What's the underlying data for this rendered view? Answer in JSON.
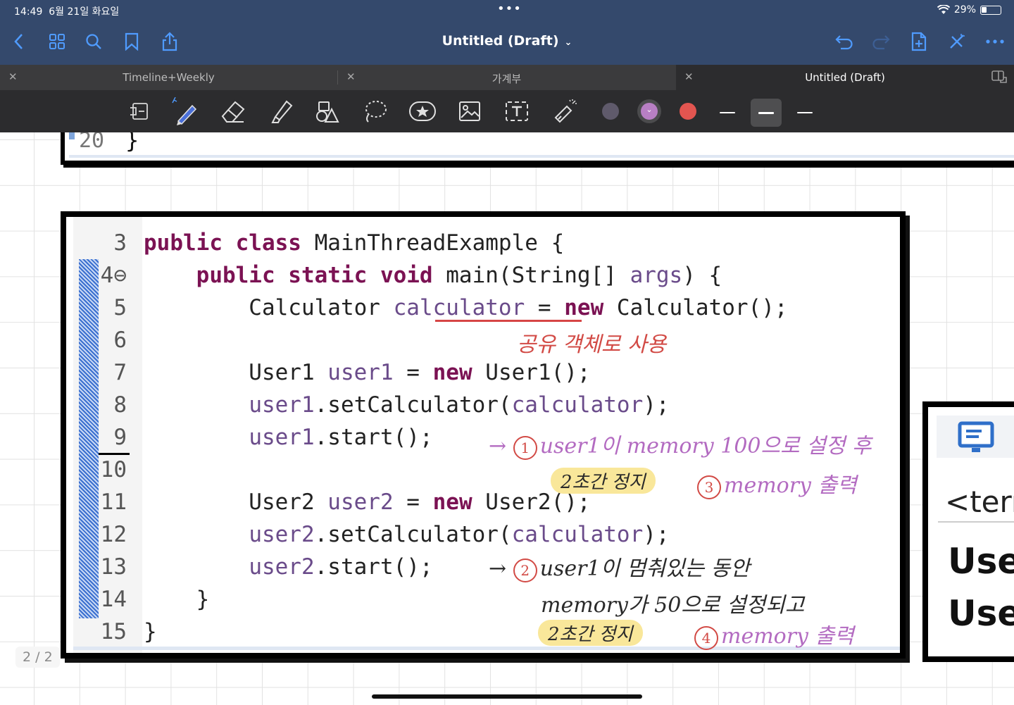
{
  "status": {
    "time": "14:49",
    "date": "6월 21일 화요일",
    "battery": "29%",
    "battery_level": 0.29
  },
  "nav": {
    "title": "Untitled (Draft)",
    "left_icons": [
      "back-chevron-icon",
      "grid-icon",
      "search-icon",
      "bookmark-icon",
      "share-icon"
    ],
    "right_icons": [
      "undo-icon",
      "redo-icon",
      "add-page-icon",
      "close-x-icon",
      "more-icon"
    ]
  },
  "tabs": [
    {
      "label": "Timeline+Weekly",
      "active": false
    },
    {
      "label": "가계부",
      "active": false
    },
    {
      "label": "Untitled (Draft)",
      "active": true
    }
  ],
  "toolbar": {
    "tools": [
      "read-mode-icon",
      "pen-icon",
      "eraser-icon",
      "highlighter-icon",
      "shapes-icon",
      "lasso-icon",
      "sticker-icon",
      "image-icon",
      "text-icon",
      "laser-pointer-icon"
    ],
    "colors": [
      "#5f5a6b",
      "#b87fc4",
      "#e25550"
    ],
    "selected_color_index": 1
  },
  "canvas": {
    "top_shot": {
      "line_number": "20",
      "code": "}"
    },
    "code_lines": [
      {
        "n": "3",
        "parts": [
          [
            "kw",
            "public class "
          ],
          [
            "",
            "MainThreadExample {"
          ]
        ]
      },
      {
        "n": "4⊖",
        "parts": [
          [
            "",
            "    "
          ],
          [
            "kw",
            "public static void "
          ],
          [
            "",
            "main(String[] "
          ],
          [
            "var",
            "args"
          ],
          [
            "",
            ") {"
          ]
        ]
      },
      {
        "n": "5",
        "parts": [
          [
            "",
            "        Calculator "
          ],
          [
            "var",
            "calculator"
          ],
          [
            "",
            " = "
          ],
          [
            "kw",
            "new "
          ],
          [
            "",
            "Calculator();"
          ]
        ]
      },
      {
        "n": "6",
        "parts": []
      },
      {
        "n": "7",
        "parts": [
          [
            "",
            "        User1 "
          ],
          [
            "var",
            "user1"
          ],
          [
            "",
            " = "
          ],
          [
            "kw",
            "new "
          ],
          [
            "",
            "User1();"
          ]
        ]
      },
      {
        "n": "8",
        "parts": [
          [
            "",
            "        "
          ],
          [
            "var",
            "user1"
          ],
          [
            "",
            ".setCalculator("
          ],
          [
            "var",
            "calculator"
          ],
          [
            "",
            ");"
          ]
        ]
      },
      {
        "n": "9",
        "parts": [
          [
            "",
            "        "
          ],
          [
            "var",
            "user1"
          ],
          [
            "",
            ".start();"
          ]
        ]
      },
      {
        "n": "10",
        "parts": []
      },
      {
        "n": "11",
        "parts": [
          [
            "",
            "        User2 "
          ],
          [
            "var",
            "user2"
          ],
          [
            "",
            " = "
          ],
          [
            "kw",
            "new "
          ],
          [
            "",
            "User2();"
          ]
        ]
      },
      {
        "n": "12",
        "parts": [
          [
            "",
            "        "
          ],
          [
            "var",
            "user2"
          ],
          [
            "",
            ".setCalculator("
          ],
          [
            "var",
            "calculator"
          ],
          [
            "",
            ");"
          ]
        ]
      },
      {
        "n": "13",
        "parts": [
          [
            "",
            "        "
          ],
          [
            "var",
            "user2"
          ],
          [
            "",
            ".start();"
          ]
        ]
      },
      {
        "n": "14",
        "parts": [
          [
            "",
            "    }"
          ]
        ]
      },
      {
        "n": "15",
        "parts": [
          [
            "",
            "}"
          ]
        ]
      }
    ],
    "notes": {
      "shared": "공유 객체로 사용",
      "n1_num": "1",
      "n1_text": "user1이 memory 100으로 설정 후",
      "pause1": "2초간 정지",
      "n3_num": "3",
      "n3_text": "memory 출력",
      "n2_num": "2",
      "n2_text": "user1이 멈춰있는 동안",
      "n2b_text": "memory가 50으로 설정되고",
      "pause2": "2초간 정지",
      "n4_num": "4",
      "n4_text": "memory 출력"
    },
    "right_shot": {
      "term": "<tern",
      "line1": "Use",
      "line2": "Use"
    },
    "page_counter": "2 / 2"
  }
}
